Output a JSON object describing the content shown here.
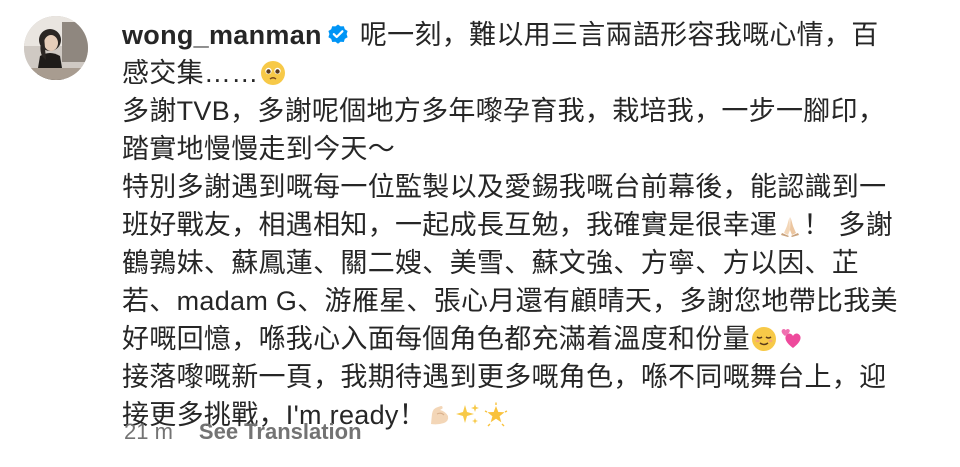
{
  "comment": {
    "username": "wong_manman",
    "verified_icon": "verified-badge-icon",
    "lines": [
      "呢一刻，難以用三言兩語形容我嘅心情，百",
      "感交集……",
      "多謝TVB，多謝呢個地方多年嚟孕育我，栽培我，一步一腳印，",
      "踏實地慢慢走到今天～",
      "特別多謝遇到嘅每一位監製以及愛錫我嘅台前幕後，能認識到一",
      "班好戰友，相遇相知，一起成長互勉，我確實是很幸運",
      "！ 多謝",
      "鶴鶉妹、蘇鳳蓮、關二嫂、美雪、蘇文強、方寧、方以因、芷",
      "若、madam G、游雁星、張心月還有顧晴天，多謝您地帶比我美",
      "好嘅回憶，喺我心入面每個角色都充滿着溫度和份量",
      "接落嚟嘅新一頁，我期待遇到更多嘅角色，喺不同嘅舞台上，迎",
      "接更多挑戰，I'm ready！"
    ],
    "emojis": [
      "pleading-face-icon",
      "folded-hands-icon",
      "relieved-face-icon",
      "two-hearts-icon",
      "flexed-biceps-icon",
      "sparkles-icon",
      "glowing-star-icon"
    ]
  },
  "meta": {
    "time": "21 m",
    "see_translation": "See Translation"
  },
  "colors": {
    "text": "#262626",
    "secondary": "#737373",
    "verified": "#0095f6"
  }
}
